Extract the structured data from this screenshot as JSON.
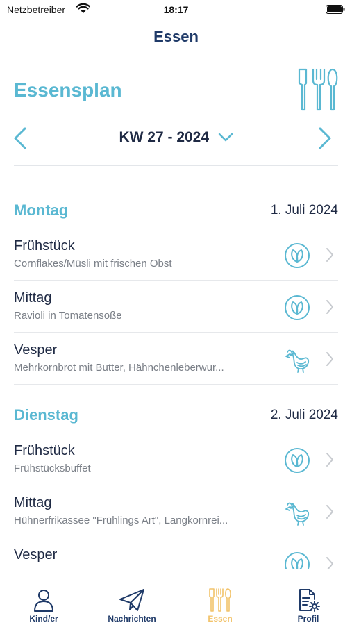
{
  "status_bar": {
    "carrier": "Netzbetreiber",
    "time": "18:17"
  },
  "nav": {
    "title": "Essen"
  },
  "page": {
    "title": "Essensplan"
  },
  "week": {
    "label": "KW 27 - 2024"
  },
  "days": [
    {
      "name": "Montag",
      "date": "1. Juli 2024",
      "meals": [
        {
          "type": "Frühstück",
          "description": "Cornflakes/Müsli mit frischen Obst",
          "icon": "leaf-icon"
        },
        {
          "type": "Mittag",
          "description": "Ravioli in Tomatensoße",
          "icon": "leaf-icon"
        },
        {
          "type": "Vesper",
          "description": "Mehrkornbrot mit Butter, Hähnchenleberwur...",
          "icon": "chicken-icon"
        }
      ]
    },
    {
      "name": "Dienstag",
      "date": "2. Juli 2024",
      "meals": [
        {
          "type": "Frühstück",
          "description": "Frühstücksbuffet",
          "icon": "leaf-icon"
        },
        {
          "type": "Mittag",
          "description": "Hühnerfrikassee \"Frühlings Art\",  Langkornrei...",
          "icon": "chicken-icon"
        },
        {
          "type": "Vesper",
          "description": "",
          "icon": "leaf-icon"
        }
      ]
    }
  ],
  "tabs": [
    {
      "label": "Kind/er",
      "icon": "person-icon"
    },
    {
      "label": "Nachrichten",
      "icon": "paper-plane-icon"
    },
    {
      "label": "Essen",
      "icon": "cutlery-icon",
      "active": true
    },
    {
      "label": "Profil",
      "icon": "document-gear-icon"
    }
  ],
  "colors": {
    "accent": "#5ab8d2",
    "navy": "#1f3a68",
    "active_tab": "#f2c36b",
    "muted": "#7a7f87"
  }
}
